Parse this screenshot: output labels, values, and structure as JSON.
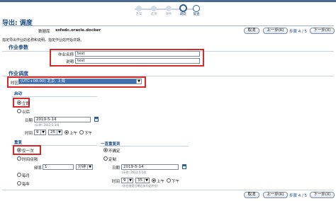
{
  "train": {
    "steps": [
      "方案",
      "选项",
      "文件",
      "调度",
      "复查"
    ],
    "active_index": 3
  },
  "page_title": "导出: 调度",
  "database": {
    "label": "数据库",
    "value": "ssfedc.oracle.docker"
  },
  "instructions": "指定导出作业的名称和说明。指定作业的开始日期。",
  "buttons": {
    "cancel": "取消",
    "back": "上一步(K)",
    "step": "步骤 4 / 5",
    "next": "下一步(X)"
  },
  "job_params": {
    "title": "作业参数",
    "name_label": "作业名称",
    "name_value": "test",
    "desc_label": "说明",
    "desc_value": "test"
  },
  "job_schedule": {
    "title": "作业调度",
    "timezone_label": "时区",
    "timezone_value": "(UTC+08:00) 北京, 上海"
  },
  "start": {
    "title": "启动",
    "immediately": "立即",
    "later": "以后",
    "date_label": "日期",
    "date_value": "2019-5-14",
    "date_hint": "(示例: 2012-5-14)",
    "time_label": "时间",
    "hour": "9",
    "minute": "25",
    "am": "上午",
    "pm": "下午"
  },
  "repeat": {
    "title": "重复",
    "once": "仅一次",
    "interval": "时间间隔",
    "freq_label": "频率",
    "freq_value": "1",
    "freq_unit": "分钟",
    "monthly": "每月",
    "yearly": "每年"
  },
  "repeat_until": {
    "title": "一直重复到",
    "indefinite": "不确定",
    "custom": "定制",
    "date_label": "日期",
    "date_value": "2019-5-14",
    "date_hint": "(示例: 2012-5-14)",
    "time_label": "时间",
    "hour": "9",
    "minute": "35",
    "am": "上午",
    "pm": "下午",
    "time_hint": "(仅在指定日期后执行此作业)"
  },
  "colors": {
    "accent": "#1d4d86",
    "highlight": "#d42a2a",
    "select": "#3d70b3"
  }
}
